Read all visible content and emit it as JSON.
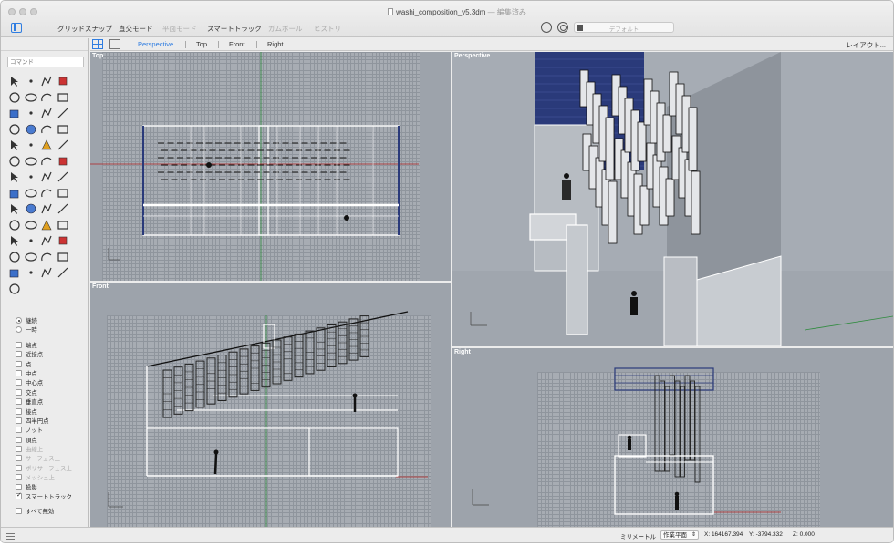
{
  "window": {
    "title": "washi_composition_v5.3dm",
    "title_status": "— 編集済み"
  },
  "toolbar": {
    "items": [
      "グリッドスナップ",
      "直交モード",
      "平面モード",
      "スマートトラック",
      "ガムボール",
      "ヒストリ"
    ],
    "layer_name": "デフォルト"
  },
  "command": {
    "placeholder": "コマンド"
  },
  "viewtabs": {
    "tabs": [
      "Perspective",
      "Top",
      "Front",
      "Right"
    ],
    "active": "Perspective",
    "layout_label": "レイアウト..."
  },
  "viewports": {
    "top_label": "Top",
    "front_label": "Front",
    "perspective_label": "Perspective",
    "right_label": "Right"
  },
  "osnap": {
    "persistent": "継続",
    "one_shot": "一時",
    "items": [
      {
        "label": "端点",
        "checked": false,
        "enabled": true
      },
      {
        "label": "近接点",
        "checked": false,
        "enabled": true
      },
      {
        "label": "点",
        "checked": false,
        "enabled": true
      },
      {
        "label": "中点",
        "checked": false,
        "enabled": true
      },
      {
        "label": "中心点",
        "checked": false,
        "enabled": true
      },
      {
        "label": "交点",
        "checked": false,
        "enabled": true
      },
      {
        "label": "垂直点",
        "checked": false,
        "enabled": true
      },
      {
        "label": "接点",
        "checked": false,
        "enabled": true
      },
      {
        "label": "四半円点",
        "checked": false,
        "enabled": true
      },
      {
        "label": "ノット",
        "checked": false,
        "enabled": true
      },
      {
        "label": "頂点",
        "checked": false,
        "enabled": true
      },
      {
        "label": "曲線上",
        "checked": false,
        "enabled": false
      },
      {
        "label": "サーフェス上",
        "checked": false,
        "enabled": false
      },
      {
        "label": "ポリサーフェス上",
        "checked": false,
        "enabled": false
      },
      {
        "label": "メッシュ上",
        "checked": false,
        "enabled": false
      },
      {
        "label": "投影",
        "checked": false,
        "enabled": true
      },
      {
        "label": "スマートトラック",
        "checked": true,
        "enabled": true
      }
    ],
    "disable_all": "すべて無効"
  },
  "statusbar": {
    "units": "ミリメートル",
    "cplane": "作業平面",
    "x": "X: 164167.394",
    "y": "Y: -3794.332",
    "z": "Z: 0.000"
  },
  "tools": [
    "select-arrow",
    "point",
    "polyline",
    "line",
    "circle",
    "ellipse",
    "arc",
    "rectangle",
    "rotate",
    "curve-from-object",
    "fillet",
    "split",
    "polygon",
    "surface",
    "extrude",
    "loft",
    "box",
    "shading",
    "warning",
    "transform",
    "sphere",
    "cylinder",
    "cone",
    "pipe",
    "mirror",
    "array",
    "gumball",
    "edit",
    "cube",
    "grid-points",
    "pattern",
    "boolean",
    "solid",
    "polyline-edit",
    "trim",
    "join",
    "zoom",
    "rotate-view",
    "select",
    "pan",
    "analyze",
    "layer",
    "display",
    "curvature",
    "light",
    "palette",
    "color-wheel",
    "render",
    "globe",
    "properties",
    "sphere-render",
    "flag",
    "dimension"
  ],
  "colors": {
    "accent": "#2f7de1",
    "viewport_bg": "#9da3ab",
    "axis_x": "#b22222",
    "axis_y": "#2e8b3d",
    "object_navy": "#2a3a7a"
  }
}
